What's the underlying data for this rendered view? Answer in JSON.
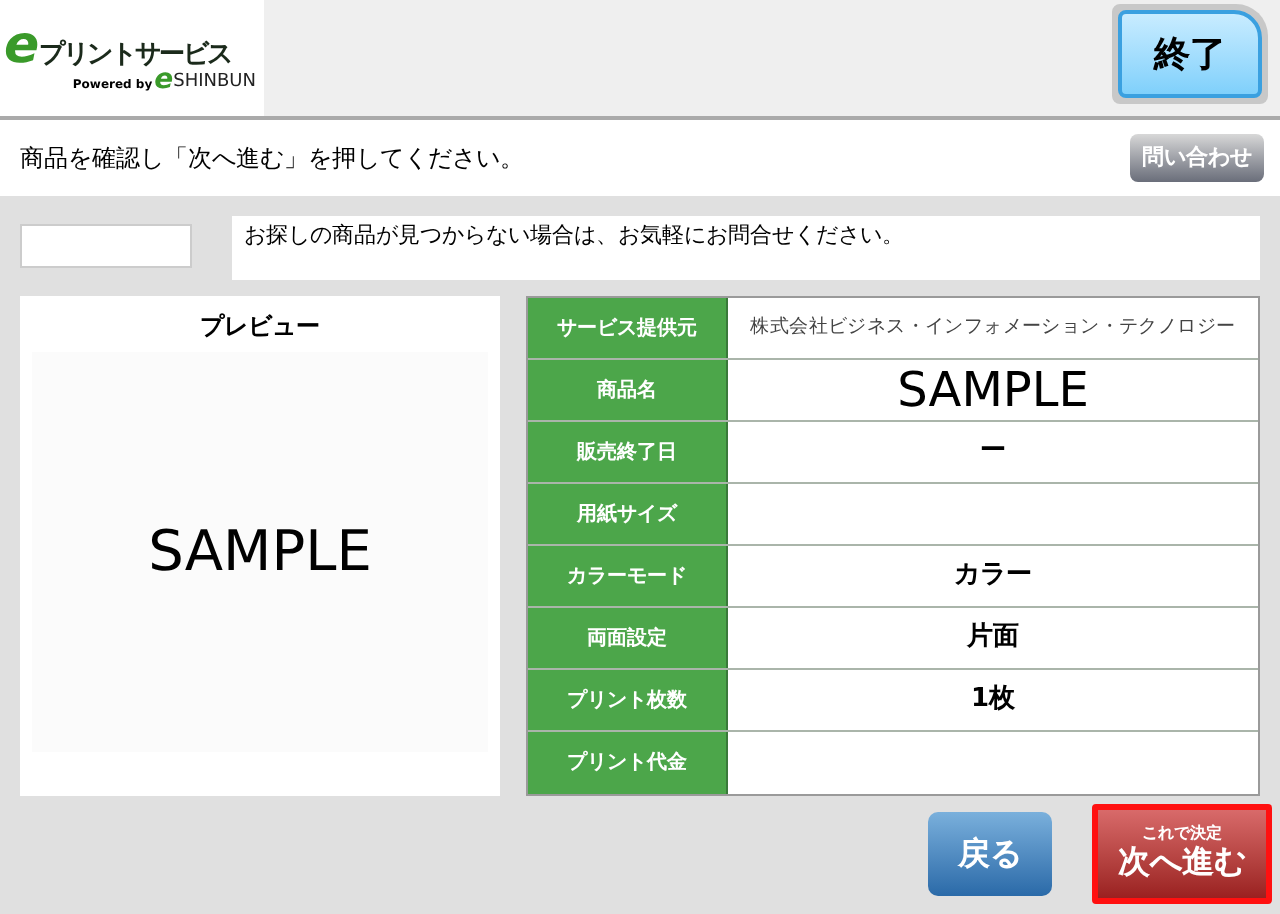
{
  "logo": {
    "mark": "e",
    "title": "プリントサービス",
    "powered": "Powered by",
    "brand_mark": "e",
    "brand": "SHINBUN"
  },
  "end_button": "終了",
  "instruction": "商品を確認し「次へ進む」を押してください。",
  "contact_button": "問い合わせ",
  "notice": "お探しの商品が見つからない場合は、お気軽にお問合せください。",
  "preview": {
    "title": "プレビュー",
    "sample": "SAMPLE"
  },
  "details": [
    {
      "label": "サービス提供元",
      "value": "株式会社ビジネス・インフォメーション・テクノロジー",
      "kind": "small"
    },
    {
      "label": "商品名",
      "value": "SAMPLE",
      "kind": "large"
    },
    {
      "label": "販売終了日",
      "value": "ー",
      "kind": "normal"
    },
    {
      "label": "用紙サイズ",
      "kind": "normal"
    },
    {
      "label": "カラーモード",
      "value": "カラー",
      "kind": "normal"
    },
    {
      "label": "両面設定",
      "value": "片面",
      "kind": "normal"
    },
    {
      "label": "プリント枚数",
      "value": "1枚",
      "kind": "normal"
    },
    {
      "label": "プリント代金",
      "kind": "normal"
    }
  ],
  "back_button": "戻る",
  "next_button": {
    "caption": "これで決定",
    "label": "次へ進む",
    "focused": true
  }
}
